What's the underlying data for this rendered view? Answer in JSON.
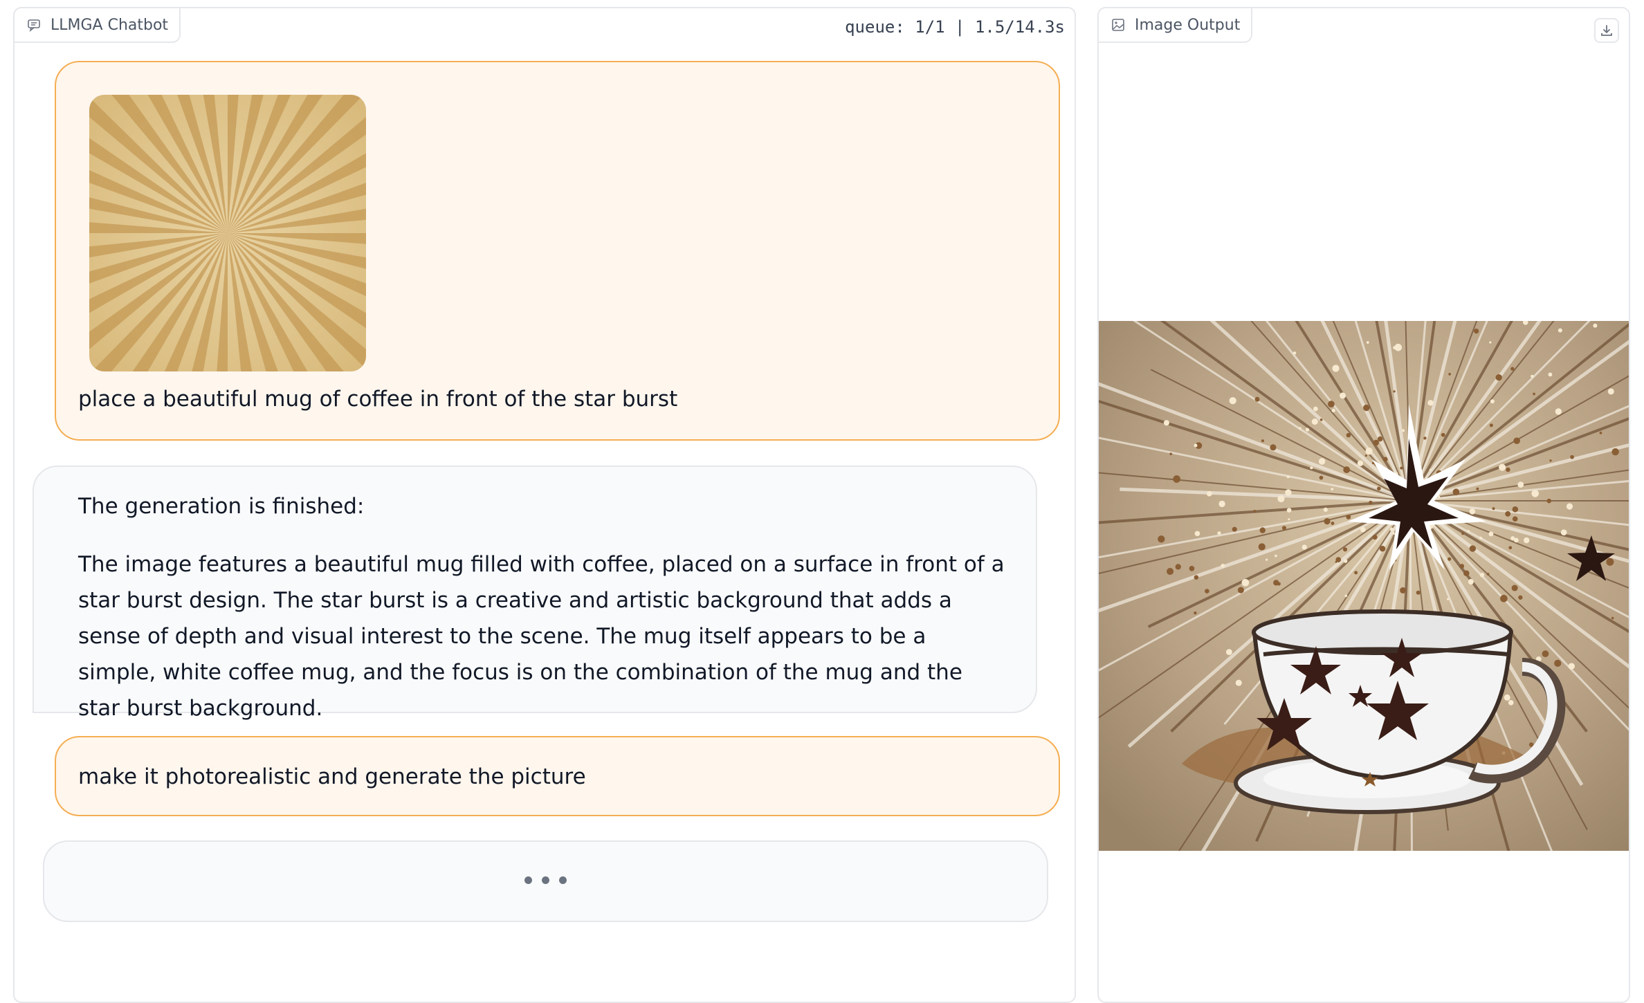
{
  "chat_panel": {
    "label": "LLMGA Chatbot",
    "label_icon": "chat-icon",
    "queue_status": "queue: 1/1 | 1.5/14.3s"
  },
  "messages": [
    {
      "role": "user",
      "image": "sunburst-image",
      "text": "place a beautiful mug of coffee in front of the star burst"
    },
    {
      "role": "bot",
      "heading": "The generation is finished:",
      "text": "The image features a beautiful mug filled with coffee, placed on a surface in front of a star burst design. The star burst is a creative and artistic background that adds a sense of depth and visual interest to the scene. The mug itself appears to be a simple, white coffee mug, and the focus is on the combination of the mug and the star burst background."
    },
    {
      "role": "user",
      "text": "make it photorealistic and generate the picture"
    },
    {
      "role": "bot",
      "loading": true
    }
  ],
  "output_panel": {
    "label": "Image Output",
    "label_icon": "image-icon",
    "download_icon": "download-icon",
    "image": "coffee-mug-starburst-image"
  },
  "colors": {
    "user_bubble_bg": "#fff6ed",
    "user_bubble_border": "#f5ae53",
    "bot_bubble_bg": "#f9fafb",
    "panel_border": "#e5e7eb"
  }
}
